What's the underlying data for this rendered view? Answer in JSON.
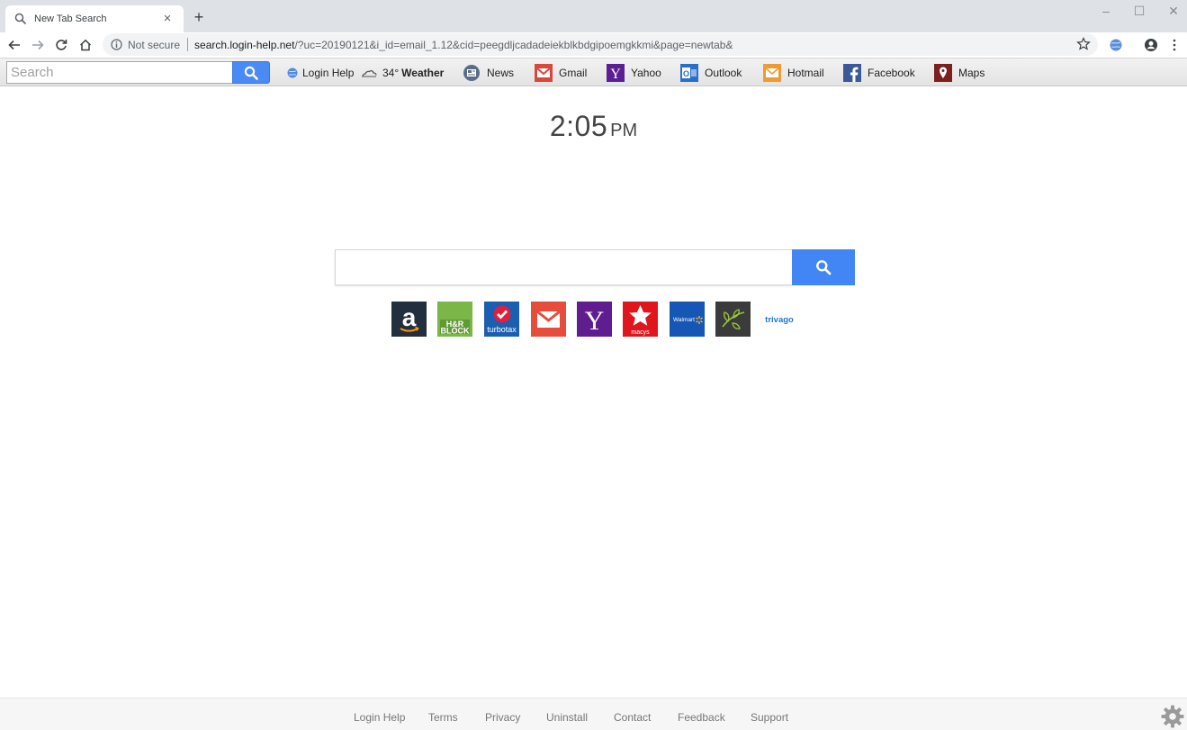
{
  "browser": {
    "tab_title": "New Tab Search",
    "tab_close": "×",
    "new_tab": "+",
    "window_controls": {
      "minimize": "–",
      "maximize": "☐",
      "close": "✕"
    },
    "security_label": "Not secure",
    "url_host": "search.login-help.net",
    "url_path": "/?uc=20190121&i_id=email_1.12&cid=peegdljcadadeiekblkbdgipoemgkkmi&page=newtab&"
  },
  "toolbar": {
    "search_placeholder": "Search",
    "items": [
      {
        "label": "Login Help",
        "icon": "globe-icon"
      },
      {
        "label": "34°",
        "bold": "Weather",
        "icon": "cloud-icon"
      },
      {
        "label": "News",
        "icon": "newspaper-icon"
      },
      {
        "label": "Gmail",
        "icon": "gmail-icon"
      },
      {
        "label": "Yahoo",
        "icon": "yahoo-icon"
      },
      {
        "label": "Outlook",
        "icon": "outlook-icon"
      },
      {
        "label": "Hotmail",
        "icon": "hotmail-icon"
      },
      {
        "label": "Facebook",
        "icon": "facebook-icon"
      },
      {
        "label": "Maps",
        "icon": "map-pin-icon"
      }
    ]
  },
  "clock": {
    "time": "2:05",
    "ampm": "PM"
  },
  "tiles": [
    {
      "name": "amazon",
      "text": "a",
      "bg": "#232f3e"
    },
    {
      "name": "hrblock",
      "text": "H&R BLOCK",
      "bg": "#7ab648"
    },
    {
      "name": "turbotax",
      "text": "turbotax",
      "bg": "#1b5fb0"
    },
    {
      "name": "gmail",
      "text": "",
      "bg": "#e74c3c"
    },
    {
      "name": "yahoo",
      "text": "Y",
      "bg": "#5f1d8f"
    },
    {
      "name": "macys",
      "text": "macys",
      "bg": "#e0161f"
    },
    {
      "name": "walmart",
      "text": "Walmart",
      "bg": "#1657b6"
    },
    {
      "name": "ancestry",
      "text": "",
      "bg": "#3b3b3b"
    },
    {
      "name": "trivago",
      "text": "trivago",
      "bg": "#ffffff"
    }
  ],
  "footer": {
    "links": [
      "Login Help",
      "Terms",
      "Privacy",
      "Uninstall",
      "Contact",
      "Feedback",
      "Support"
    ]
  },
  "colors": {
    "accent": "#4285f4",
    "toolbar_btn": "#4a8af4"
  }
}
